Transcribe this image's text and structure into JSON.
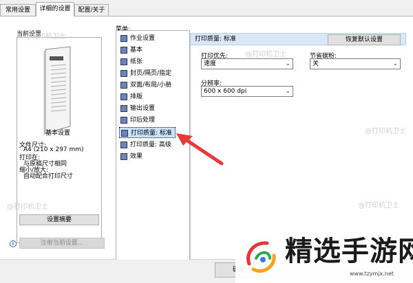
{
  "tabs": [
    {
      "label": "常用设置"
    },
    {
      "label": "详细的设置",
      "active": true
    },
    {
      "label": "配置/关于"
    }
  ],
  "left": {
    "preview_label": "当前设置",
    "basic_title": "基本设置",
    "lines": [
      "文件尺寸:",
      "A4 (210 x 297 mm)",
      "打印在:",
      "与原稿尺寸相同",
      "缩小/放大:",
      "自动配合打印尺寸"
    ],
    "summary_button": "设置摘要",
    "register_button": "注册当前设置..."
  },
  "menu": {
    "label": "菜单:",
    "items": [
      {
        "label": "作业设置"
      },
      {
        "label": "基本"
      },
      {
        "label": "纸张"
      },
      {
        "label": "封页/隔页/指定"
      },
      {
        "label": "双面/布局/小册"
      },
      {
        "label": "排版"
      },
      {
        "label": "输出设置"
      },
      {
        "label": "印后处理"
      },
      {
        "label": "打印质量: 标准",
        "selected": true
      },
      {
        "label": "打印质量: 高级"
      },
      {
        "label": "效果"
      }
    ]
  },
  "right": {
    "header": "打印质量: 标准",
    "restore_button": "恢复默认设置",
    "priority_label": "打印优先:",
    "priority_value": "速度",
    "toner_label": "节省碳粉:",
    "toner_value": "关",
    "resolution_label": "分辨率:",
    "resolution_value": "600 x 600 dpi"
  },
  "footer": {
    "ok_button": "确定"
  },
  "watermark": "@打印机卫士",
  "brand": {
    "name": "精选手游网",
    "url": "www.tzymjx.net"
  },
  "colors": {
    "arrow": "#e83a3a",
    "header_bg": "#d9e7f7",
    "selection_bg": "#cce4ff"
  }
}
